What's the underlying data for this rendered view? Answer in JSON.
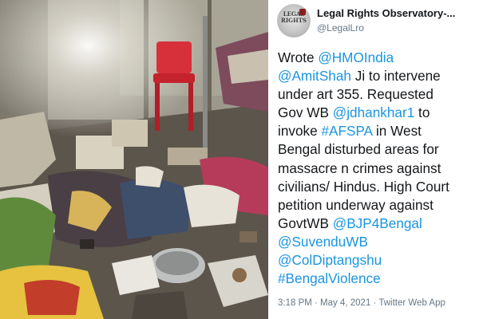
{
  "photo": {
    "alt_icon": "ransacked-room-photo"
  },
  "tweet": {
    "display_name": "Legal Rights Observatory-...",
    "handle": "@LegalLro",
    "avatar_text": "LEGAL RIGHTS",
    "lines": [
      [
        {
          "t": "Wrote ",
          "link": false
        },
        {
          "t": "@HMOIndia",
          "link": true
        }
      ],
      [
        {
          "t": "@AmitShah",
          "link": true
        },
        {
          "t": " Ji to intervene",
          "link": false
        }
      ],
      [
        {
          "t": "under art 355. Requested",
          "link": false
        }
      ],
      [
        {
          "t": "Gov WB ",
          "link": false
        },
        {
          "t": "@jdhankhar1",
          "link": true
        },
        {
          "t": " to",
          "link": false
        }
      ],
      [
        {
          "t": "invoke ",
          "link": false
        },
        {
          "t": "#AFSPA",
          "link": true
        },
        {
          "t": " in West",
          "link": false
        }
      ],
      [
        {
          "t": "Bengal disturbed areas for",
          "link": false
        }
      ],
      [
        {
          "t": "massacre n crimes against",
          "link": false
        }
      ],
      [
        {
          "t": "civilians/ Hindus. High Court",
          "link": false
        }
      ],
      [
        {
          "t": "petition underway against",
          "link": false
        }
      ],
      [
        {
          "t": "GovtWB ",
          "link": false
        },
        {
          "t": "@BJP4Bengal",
          "link": true
        }
      ],
      [
        {
          "t": "@SuvenduWB",
          "link": true
        }
      ],
      [
        {
          "t": "@ColDiptangshu",
          "link": true
        }
      ],
      [
        {
          "t": "#BengalViolence",
          "link": true
        }
      ]
    ],
    "meta": "3:18 PM · May 4, 2021 · Twitter Web App",
    "link_color": "#1b95e0"
  }
}
